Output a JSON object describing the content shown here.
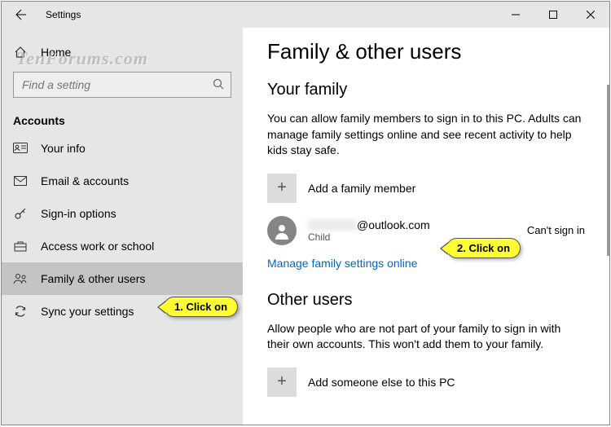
{
  "window": {
    "title": "Settings"
  },
  "sidebar": {
    "home": "Home",
    "search_placeholder": "Find a setting",
    "section": "Accounts",
    "items": [
      {
        "label": "Your info"
      },
      {
        "label": "Email & accounts"
      },
      {
        "label": "Sign-in options"
      },
      {
        "label": "Access work or school"
      },
      {
        "label": "Family & other users"
      },
      {
        "label": "Sync your settings"
      }
    ]
  },
  "main": {
    "title": "Family & other users",
    "family_hdr": "Your family",
    "family_desc": "You can allow family members to sign in to this PC. Adults can manage family settings online and see recent activity to help kids stay safe.",
    "add_family": "Add a family member",
    "user": {
      "email_suffix": "@outlook.com",
      "role": "Child",
      "status": "Can't sign in"
    },
    "manage_link": "Manage family settings online",
    "others_hdr": "Other users",
    "others_desc": "Allow people who are not part of your family to sign in with their own accounts. This won't add them to your family.",
    "add_other": "Add someone else to this PC"
  },
  "annotations": {
    "c1": "1. Click on",
    "c2": "2. Click on",
    "watermark": "TenForums.com"
  }
}
